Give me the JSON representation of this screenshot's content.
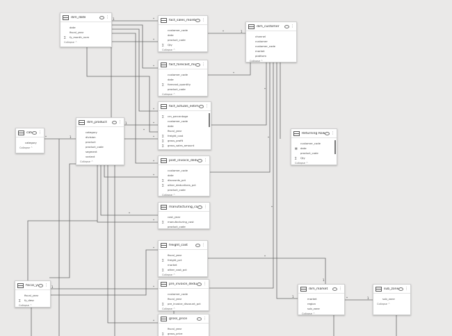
{
  "tables": {
    "dim_date": {
      "name": "dim_date",
      "fields": [
        {
          "t": "date"
        },
        {
          "t": "fiscal_year"
        },
        {
          "t": "fy_month_num",
          "icon": "sum"
        }
      ],
      "footer": "Collapse ^"
    },
    "fact_sales_monthly": {
      "name": "fact_sales_monthly",
      "fields": [
        {
          "t": "customer_code"
        },
        {
          "t": "date"
        },
        {
          "t": "product_code"
        },
        {
          "t": "Qty",
          "icon": "sum"
        }
      ],
      "footer": "Collapse ^"
    },
    "dim_customer": {
      "name": "dim_customer",
      "fields": [
        {
          "t": "channel"
        },
        {
          "t": "customer"
        },
        {
          "t": "customer_code"
        },
        {
          "t": "market"
        },
        {
          "t": "platform"
        }
      ],
      "footer": "Collapse ^"
    },
    "fact_forecast_monthly": {
      "name": "fact_forecast_monthly",
      "fields": [
        {
          "t": "customer_code"
        },
        {
          "t": "date"
        },
        {
          "t": "forecast_quantity",
          "icon": "sum"
        },
        {
          "t": "product_code"
        }
      ],
      "footer": "Collapse ^"
    },
    "fact_actuals_estimates": {
      "name": "fact_actuals_estimates",
      "fields": [
        {
          "t": "cm_percentage",
          "icon": "sum"
        },
        {
          "t": "customer_code"
        },
        {
          "t": "date"
        },
        {
          "t": "fiscal_year"
        },
        {
          "t": "freight_cost",
          "icon": "sum"
        },
        {
          "t": "gross_profit",
          "icon": "sum"
        },
        {
          "t": "gross_sales_amount",
          "icon": "sum"
        }
      ],
      "footer": "Collapse ^"
    },
    "category": {
      "name": "category",
      "fields": [
        {
          "t": "category"
        }
      ],
      "footer": "Collapse ^"
    },
    "dim_product": {
      "name": "dim_product",
      "fields": [
        {
          "t": "category"
        },
        {
          "t": "division"
        },
        {
          "t": "product"
        },
        {
          "t": "product_code"
        },
        {
          "t": "segment"
        },
        {
          "t": "variant"
        }
      ],
      "footer": "Collapse ^"
    },
    "returning_rows": {
      "name": "Returning Rows...",
      "fields": [
        {
          "t": "customer_code"
        },
        {
          "t": "date",
          "icon": "cal"
        },
        {
          "t": "product_code"
        },
        {
          "t": "Qty",
          "icon": "sum"
        }
      ],
      "footer": "Collapse ^"
    },
    "post_invoice_deductions": {
      "name": "post_invoice_deductions",
      "fields": [
        {
          "t": "customer_code"
        },
        {
          "t": "date"
        },
        {
          "t": "discounts_pct",
          "icon": "sum"
        },
        {
          "t": "other_deductions_pct",
          "icon": "sum"
        },
        {
          "t": "product_code"
        }
      ],
      "footer": "Collapse ^"
    },
    "manufacturing_cost": {
      "name": "manufacturing_cost",
      "fields": [
        {
          "t": "cost_year"
        },
        {
          "t": "manufacturing_cost",
          "icon": "sum"
        },
        {
          "t": "product_code"
        }
      ],
      "footer": "Collapse ^"
    },
    "freight_cost": {
      "name": "freight_cost",
      "fields": [
        {
          "t": "fiscal_year"
        },
        {
          "t": "freight_pct",
          "icon": "sum"
        },
        {
          "t": "market"
        },
        {
          "t": "other_cost_pct",
          "icon": "sum"
        }
      ],
      "footer": "Collapse ^"
    },
    "fiscal_year": {
      "name": "fiscal_year",
      "fields": [
        {
          "t": "fiscal_year"
        },
        {
          "t": "fy_desc",
          "icon": "sum"
        }
      ],
      "footer": "Collapse ^"
    },
    "pre_invoice_deductions": {
      "name": "pre_invoice_deductions",
      "fields": [
        {
          "t": "customer_code"
        },
        {
          "t": "fiscal_year"
        },
        {
          "t": "pre_invoice_discount_pct",
          "icon": "sum"
        }
      ],
      "footer": "Collapse ^"
    },
    "dim_market": {
      "name": "dim_market",
      "fields": [
        {
          "t": "market"
        },
        {
          "t": "region"
        },
        {
          "t": "sub_zone"
        }
      ],
      "footer": "Collapse ^"
    },
    "sub_zone": {
      "name": "sub_zone",
      "fields": [
        {
          "t": "sub_zone"
        }
      ],
      "footer": "Collapse ^"
    },
    "gross_price": {
      "name": "gross_price",
      "fields": [
        {
          "t": "fiscal_year"
        },
        {
          "t": "gross_price",
          "icon": "sum"
        }
      ],
      "footer": ""
    }
  },
  "cardinality": {
    "one": "1",
    "many": "*"
  }
}
